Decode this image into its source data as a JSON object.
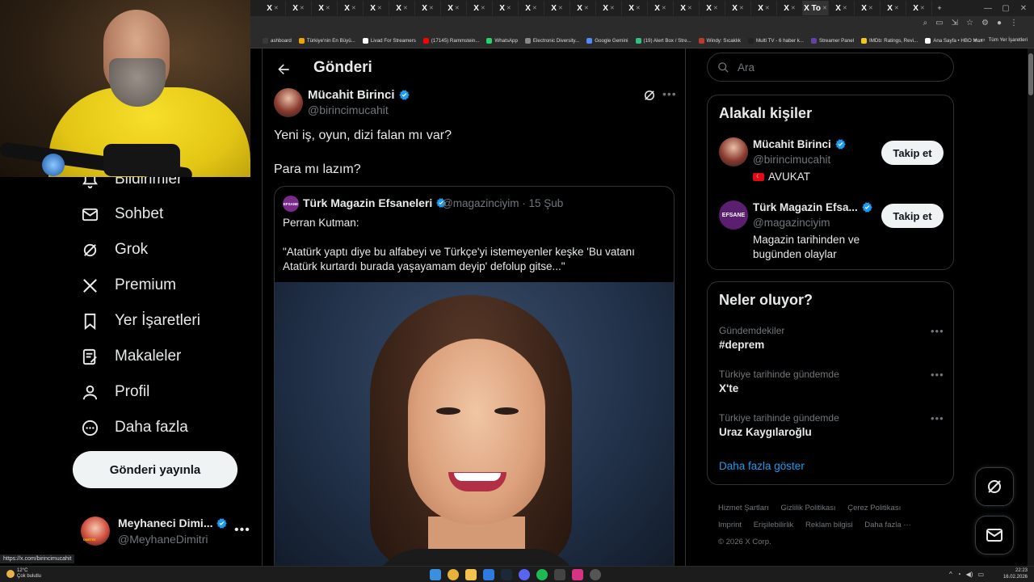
{
  "browser": {
    "tab_letter": "X",
    "tab_close": "✕",
    "active_tab_text": "X To",
    "new_tab": "+",
    "bookmarks": [
      {
        "label": "ashboard",
        "color": "#3a3a3a"
      },
      {
        "label": "Türkiye'nin En Büyü...",
        "color": "#f0a400"
      },
      {
        "label": "Livad For Streamers",
        "color": "#ffffff"
      },
      {
        "label": "(17145) Rammstein...",
        "color": "#ff0000"
      },
      {
        "label": "WhatsApp",
        "color": "#25d366"
      },
      {
        "label": "Electronic Diversity...",
        "color": "#888888"
      },
      {
        "label": "Google Gemini",
        "color": "#4f8cf7"
      },
      {
        "label": "(19) Alert Box / Stre...",
        "color": "#31c27c"
      },
      {
        "label": "Windy: Sıcaklık",
        "color": "#c0392b"
      },
      {
        "label": "Multi TV - 6 haber k...",
        "color": "#222222"
      },
      {
        "label": "Streamer Panel",
        "color": "#6441a5"
      },
      {
        "label": "IMDb: Ratings, Revi...",
        "color": "#f5c518"
      },
      {
        "label": "Ana Sayfa • HBO Max",
        "color": "#ffffff"
      }
    ],
    "bookmarks_overflow": "»",
    "all_bookmarks": "Tüm Yer İşaretleri",
    "status_url": "https://x.com/birincimucahit"
  },
  "left_nav": {
    "items": [
      {
        "label": "Bildirimler",
        "icon": "bell-icon"
      },
      {
        "label": "Sohbet",
        "icon": "mail-icon"
      },
      {
        "label": "Grok",
        "icon": "grok-icon"
      },
      {
        "label": "Premium",
        "icon": "x-logo-icon"
      },
      {
        "label": "Yer İşaretleri",
        "icon": "bookmark-icon"
      },
      {
        "label": "Makaleler",
        "icon": "article-icon"
      },
      {
        "label": "Profil",
        "icon": "profile-icon"
      },
      {
        "label": "Daha fazla",
        "icon": "more-circle-icon"
      }
    ],
    "post_button": "Gönderi yayınla",
    "account": {
      "name": "Meyhaneci Dimi...",
      "handle": "@MeyhaneDimitri",
      "avatar_text": "DİMİTRİ",
      "more": "•••"
    }
  },
  "main": {
    "title": "Gönderi",
    "author": {
      "name": "Mücahit Birinci",
      "handle": "@birincimucahit"
    },
    "more": "•••",
    "text": "Yeni iş, oyun, dizi falan mı var?\n\nPara mı lazım?",
    "quote": {
      "avatar_text": "EFSANE",
      "name": "Türk Magazin Efsaneleri",
      "meta": "@magazinciyim · 15 Şub",
      "text": "Perran Kutman:\n\n\"Atatürk yaptı diye bu alfabeyi ve Türkçe'yi istemeyenler keşke 'Bu vatanı Atatürk kurtardı burada yaşayamam deyip' defolup gitse...\""
    }
  },
  "right": {
    "search_placeholder": "Ara",
    "related": {
      "title": "Alakalı kişiler",
      "people": [
        {
          "name": "Mücahit Birinci",
          "handle": "@birincimucahit",
          "flag": "☾",
          "bio": "AVUKAT",
          "follow": "Takip et"
        },
        {
          "name": "Türk Magazin Efsa...",
          "handle": "@magazinciyim",
          "avatar_text": "EFSANE",
          "bio": "Magazin tarihinden ve bugünden olaylar",
          "follow": "Takip et"
        }
      ]
    },
    "trends": {
      "title": "Neler oluyor?",
      "items": [
        {
          "category": "Gündemdekiler",
          "name": "#deprem"
        },
        {
          "category": "Türkiye tarihinde gündemde",
          "name": "X'te"
        },
        {
          "category": "Türkiye tarihinde gündemde",
          "name": "Uraz Kaygılaroğlu"
        }
      ],
      "more": "•••",
      "show_more": "Daha fazla göster"
    },
    "footer": {
      "links": [
        "Hizmet Şartları",
        "Gizlilik Politikası",
        "Çerez Politikası",
        "Imprint",
        "Erişilebilirlik",
        "Reklam bilgisi",
        "Daha fazla ···"
      ],
      "copyright": "© 2026 X Corp."
    }
  },
  "taskbar": {
    "weather_temp": "12°C",
    "weather_desc": "Çok bulutlu",
    "time": "22:23",
    "date": "16.02.2026",
    "tray_chevron": "^"
  }
}
